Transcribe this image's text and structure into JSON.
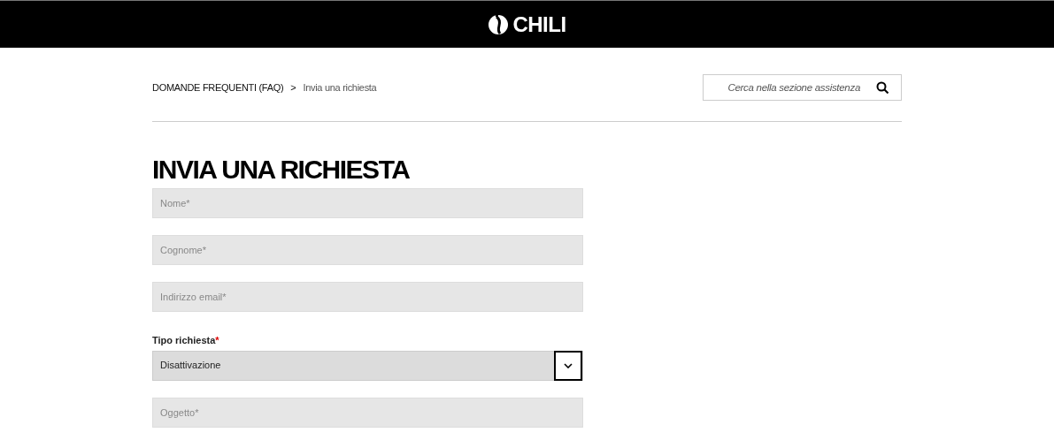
{
  "header": {
    "logo_text": "CHILI"
  },
  "breadcrumb": [
    {
      "label": "DOMANDE FREQUENTI (FAQ)",
      "current": false
    },
    {
      "label": "Invia una richiesta",
      "current": true
    }
  ],
  "breadcrumb_separator": ">",
  "search": {
    "placeholder": "Cerca nella sezione assistenza"
  },
  "title": "INVIA UNA RICHIESTA",
  "fields": [
    {
      "kind": "input",
      "placeholder": "Nome*"
    },
    {
      "kind": "input",
      "placeholder": "Cognome*"
    },
    {
      "kind": "input",
      "placeholder": "Indirizzo email*"
    },
    {
      "kind": "select",
      "label": "Tipo richiesta",
      "required_mark": "*",
      "value": "Disattivazione"
    },
    {
      "kind": "input",
      "placeholder": "Oggetto*"
    }
  ]
}
